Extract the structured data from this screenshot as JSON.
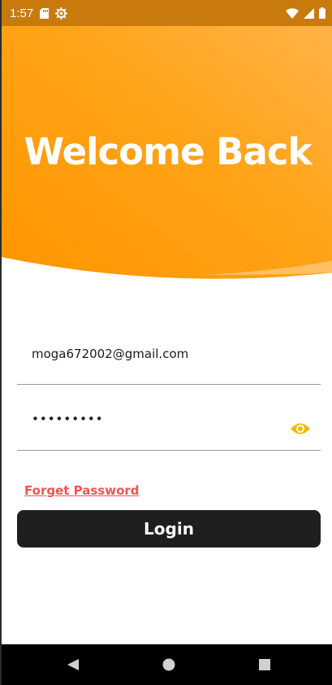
{
  "status_bar": {
    "time": "1:57",
    "icons": [
      "sd-card-icon",
      "settings-icon",
      "wifi-icon",
      "signal-icon",
      "battery-icon"
    ],
    "background": "#c97a0c"
  },
  "header": {
    "title": "Welcome Back",
    "gradient_start": "#ff9a00",
    "gradient_end": "#ffb347"
  },
  "form": {
    "email_value": "moga672002@gmail.com",
    "password_value": "•••••••••",
    "password_toggle_icon": "eye-icon",
    "accent_color": "#f2b705"
  },
  "forget_password": {
    "label": "Forget Password",
    "color": "#f05454"
  },
  "login_button": {
    "label": "Login",
    "background": "#1f1f1f"
  },
  "nav_bar": {
    "buttons": [
      "back-icon",
      "home-icon",
      "recents-icon"
    ]
  }
}
